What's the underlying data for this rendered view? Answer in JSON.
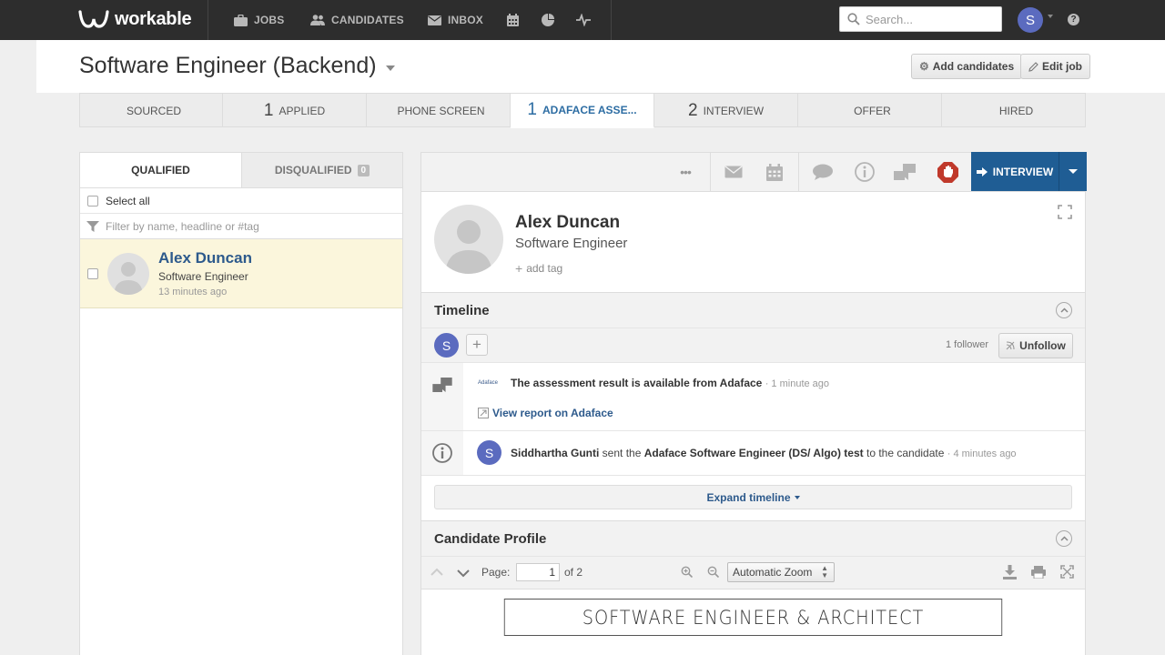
{
  "nav": {
    "logo": "workable",
    "items": [
      {
        "label": "JOBS",
        "icon": "briefcase-icon"
      },
      {
        "label": "CANDIDATES",
        "icon": "people-icon"
      },
      {
        "label": "INBOX",
        "icon": "envelope-icon"
      }
    ],
    "icons": [
      "calendar-icon",
      "pie-chart-icon",
      "activity-icon"
    ],
    "search_placeholder": "Search...",
    "user_initial": "S",
    "help": "?"
  },
  "job": {
    "title": "Software Engineer (Backend)",
    "add_candidates": "Add candidates",
    "edit_job": "Edit job"
  },
  "pipeline": [
    {
      "label": "SOURCED",
      "count": ""
    },
    {
      "label": "APPLIED",
      "count": "1"
    },
    {
      "label": "PHONE SCREEN",
      "count": ""
    },
    {
      "label": "ADAFACE ASSE...",
      "count": "1",
      "active": true
    },
    {
      "label": "INTERVIEW",
      "count": "2"
    },
    {
      "label": "OFFER",
      "count": ""
    },
    {
      "label": "HIRED",
      "count": ""
    }
  ],
  "left": {
    "tab_qualified": "QUALIFIED",
    "tab_disqualified": "DISQUALIFIED",
    "disqualified_count": "0",
    "select_all": "Select all",
    "filter_placeholder": "Filter by name, headline or #tag",
    "candidate": {
      "name": "Alex Duncan",
      "headline": "Software Engineer",
      "time": "13 minutes ago"
    }
  },
  "right": {
    "interview_button": "INTERVIEW",
    "more": "•••",
    "candidate_name": "Alex Duncan",
    "candidate_title": "Software Engineer",
    "add_tag": "add tag",
    "timeline": {
      "title": "Timeline",
      "follower_initial": "S",
      "follower_count": "1 follower",
      "unfollow": "Unfollow",
      "items": [
        {
          "source_logo": "Adaface",
          "text": "The assessment result is available from Adaface",
          "time": "· 1 minute ago",
          "link": "View report on Adaface"
        },
        {
          "actor_initial": "S",
          "actor": "Siddhartha Gunti",
          "mid": " sent the ",
          "test": "Adaface Software Engineer (DS/ Algo) test",
          "tail": " to the candidate",
          "time": "· 4 minutes ago"
        }
      ],
      "expand": "Expand timeline"
    },
    "profile_section": {
      "title": "Candidate Profile",
      "page_label": "Page:",
      "page_value": "1",
      "page_of": "of 2",
      "zoom": "Automatic Zoom",
      "doc_heading": "SOFTWARE ENGINEER  &  ARCHITECT"
    }
  },
  "colors": {
    "nav_bg": "#2d2d2d",
    "accent_blue": "#1f5d94",
    "link_blue": "#2d5a8c",
    "avatar_purple": "#5b6bbf",
    "selected_row": "#fbf6dc",
    "disqualify_red": "#c0392b"
  }
}
